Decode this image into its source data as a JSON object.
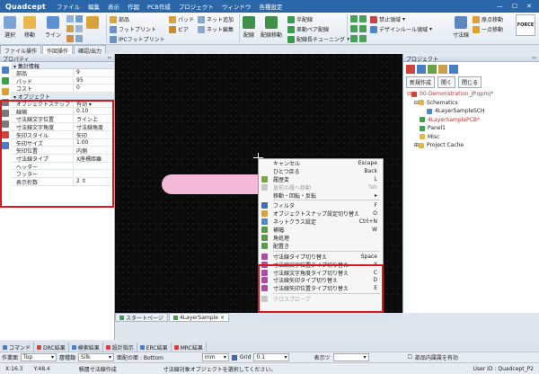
{
  "app": {
    "logo": "Quadcept",
    "menu": [
      "ファイル",
      "編集",
      "表示",
      "作図",
      "PCB作成",
      "プロジェクト",
      "ウィンドウ",
      "各種設定"
    ]
  },
  "ribbon": {
    "big1": "選択",
    "big2": "移動",
    "big3": "ライン",
    "col1": [
      "部品",
      "フットプリント",
      "IPCフットプリント"
    ],
    "col2": [
      "パッド",
      "ビア"
    ],
    "col3": [
      "ネット追加",
      "ネット編集"
    ],
    "big4": "配線",
    "big5": "配線移動",
    "col4": [
      "半配線",
      "差動ペア配線",
      "配線長チューニング"
    ],
    "col5": [
      "禁止領域",
      "デザインルール領域"
    ],
    "big6": "寸法線",
    "col6": [
      "原点移動",
      "一点移動"
    ],
    "force": "FORCE"
  },
  "doctabs": [
    "ファイル操作",
    "作図操作",
    "確認/出力"
  ],
  "props": {
    "title": "プロパティ",
    "sect1": "集計情報",
    "rows1": [
      [
        "部品",
        "9"
      ],
      [
        "パッド",
        "95"
      ],
      [
        "コスト",
        "0"
      ]
    ],
    "sect2": "オブジェクト",
    "rows2": [
      [
        "オブジェクトスナップ",
        "有効"
      ],
      [
        "線幅",
        "0.10"
      ],
      [
        "寸法線文字位置",
        "ライン上"
      ],
      [
        "寸法線文字角度",
        "寸法線角度"
      ],
      [
        "矢印スタイル",
        "矢印"
      ],
      [
        "矢印サイズ",
        "1.00"
      ],
      [
        "矢印位置",
        "内側"
      ],
      [
        "寸法線タイプ",
        "X座標距離"
      ],
      [
        "ヘッダー",
        ""
      ],
      [
        "フッター",
        ""
      ],
      [
        "表示桁数",
        "2"
      ]
    ]
  },
  "context_menu": {
    "items1": [
      [
        "キャンセル",
        "Escape"
      ],
      [
        "ひとつ戻る",
        "Back"
      ],
      [
        "履歴変",
        "L"
      ],
      [
        "直前の履へ移動",
        "Tab"
      ],
      [
        "移動・回転・反転",
        ""
      ]
    ],
    "items2": [
      [
        "フィルタ",
        "F"
      ],
      [
        "オブジェクトスナップ設定切り替え",
        "O"
      ],
      [
        "ネットクラス設定",
        "Ctrl+N"
      ],
      [
        "補幅",
        "W"
      ],
      [
        "角処理",
        ""
      ],
      [
        "配置き",
        ""
      ]
    ],
    "items3": [
      [
        "寸法線タイプ切り替え",
        "Space"
      ],
      [
        "寸法線文字位置タイプ切り替え",
        "X"
      ],
      [
        "寸法線文字角度タイプ切り替え",
        "C"
      ],
      [
        "寸法線矢印タイプ切り替え",
        "D"
      ],
      [
        "寸法線矢印位置タイプ切り替え",
        "E"
      ]
    ],
    "items4": [
      [
        "クロスプローブ",
        ""
      ]
    ]
  },
  "project": {
    "title": "プロジェクト",
    "buttons": [
      "新規作成",
      "開く",
      "閉じる"
    ],
    "tree": [
      "00-Demonstration_JP.qproj*",
      "Schematics",
      "4LayerSampleSCH",
      "4LayerSamplePCB*",
      "Panel1",
      "Misc",
      "Project Cache"
    ]
  },
  "canvas_tabs": [
    "スタートページ",
    "4LayerSample"
  ],
  "out_tabs": [
    "コマンド",
    "DRC結果",
    "検索結果",
    "設計指示",
    "ERC結果",
    "MRC結果"
  ],
  "bottombar": {
    "label1": "作業面",
    "sel1": "Top",
    "label2": "層種類",
    "sel2": "Silk",
    "label3": "面配の面 : Bottom",
    "unit": "mm",
    "grid_label": "Grid",
    "grid_val": "0.1",
    "label4": "表示ツ",
    "label5": "部品内属属を有効"
  },
  "status": {
    "x": "X:16.3",
    "y": "Y:48.4",
    "mode": "積層寸法線作成",
    "msg": "寸法線対象オブジェクトを選択してください。",
    "user": "User ID : Quadcept_P2"
  }
}
